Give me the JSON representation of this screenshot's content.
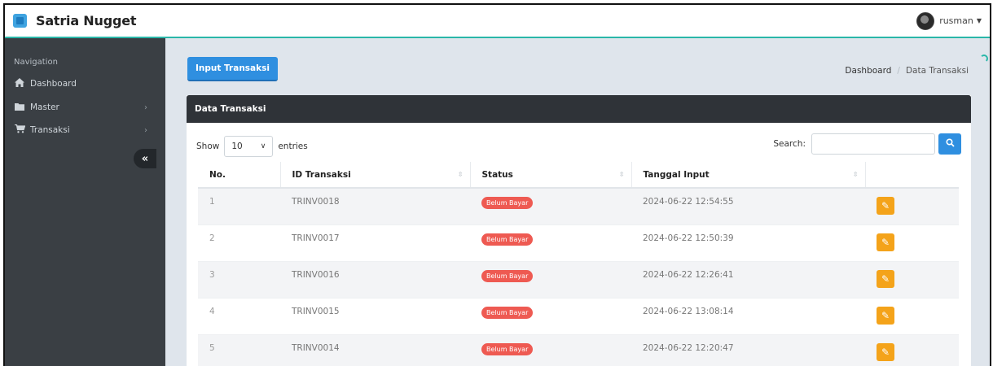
{
  "app": {
    "name": "Satria Nugget",
    "user": "rusman"
  },
  "sidebar": {
    "title": "Navigation",
    "items": [
      {
        "label": "Dashboard",
        "icon": "home-icon",
        "has_submenu": false
      },
      {
        "label": "Master",
        "icon": "folder-icon",
        "has_submenu": true
      },
      {
        "label": "Transaksi",
        "icon": "cart-icon",
        "has_submenu": true
      }
    ]
  },
  "toolbar": {
    "input_label": "Input Transaksi"
  },
  "breadcrumb": {
    "home": "Dashboard",
    "current": "Data Transaksi"
  },
  "card": {
    "title": "Data Transaksi"
  },
  "table_controls": {
    "show_label": "Show",
    "length_value": "10",
    "entries_label": "entries",
    "search_label": "Search:",
    "search_value": ""
  },
  "table": {
    "headers": [
      "No.",
      "ID Transaksi",
      "Status",
      "Tanggal Input",
      ""
    ],
    "rows": [
      {
        "no": "1",
        "id": "TRINV0018",
        "status": "Belum Bayar",
        "date": "2024-06-22 12:54:55"
      },
      {
        "no": "2",
        "id": "TRINV0017",
        "status": "Belum Bayar",
        "date": "2024-06-22 12:50:39"
      },
      {
        "no": "3",
        "id": "TRINV0016",
        "status": "Belum Bayar",
        "date": "2024-06-22 12:26:41"
      },
      {
        "no": "4",
        "id": "TRINV0015",
        "status": "Belum Bayar",
        "date": "2024-06-22 13:08:14"
      },
      {
        "no": "5",
        "id": "TRINV0014",
        "status": "Belum Bayar",
        "date": "2024-06-22 12:20:47"
      }
    ]
  },
  "colors": {
    "accent": "#2ab7a9",
    "primary": "#2f8fe0",
    "danger": "#ee5a52",
    "warning": "#f4a31a",
    "sidebar": "#3a3f44"
  }
}
